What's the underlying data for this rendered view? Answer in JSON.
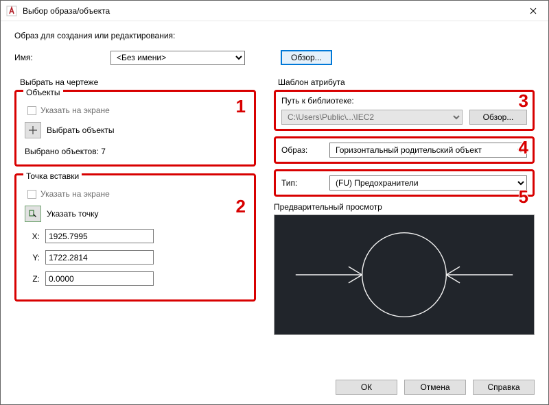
{
  "window": {
    "title": "Выбор образа/объекта"
  },
  "heading": "Образ для создания или редактирования:",
  "name": {
    "label": "Имя:",
    "value": "<Без имени>"
  },
  "browse_btn": "Обзор...",
  "select_on_dwg": "Выбрать на чертеже",
  "objects": {
    "legend": "Объекты",
    "specify_on_screen": "Указать на экране",
    "pick_objects": "Выбрать объекты",
    "selected_count": "Выбрано объектов: 7"
  },
  "insert_point": {
    "legend": "Точка вставки",
    "specify_on_screen": "Указать на экране",
    "pick_point": "Указать точку",
    "x_label": "X:",
    "x": "1925.7995",
    "y_label": "Y:",
    "y": "1722.2814",
    "z_label": "Z:",
    "z": "0.0000"
  },
  "attr_template": {
    "legend": "Шаблон атрибута",
    "lib_path_label": "Путь к библиотеке:",
    "lib_path": "C:\\Users\\Public\\...\\IEC2",
    "lib_browse": "Обзор...",
    "image_label": "Образ:",
    "image": "Горизонтальный родительский объект",
    "type_label": "Тип:",
    "type": "(FU) Предохранители"
  },
  "preview": {
    "label": "Предварительный просмотр"
  },
  "footer": {
    "ok": "ОК",
    "cancel": "Отмена",
    "help": "Справка"
  },
  "callouts": {
    "c1": "1",
    "c2": "2",
    "c3": "3",
    "c4": "4",
    "c5": "5"
  }
}
